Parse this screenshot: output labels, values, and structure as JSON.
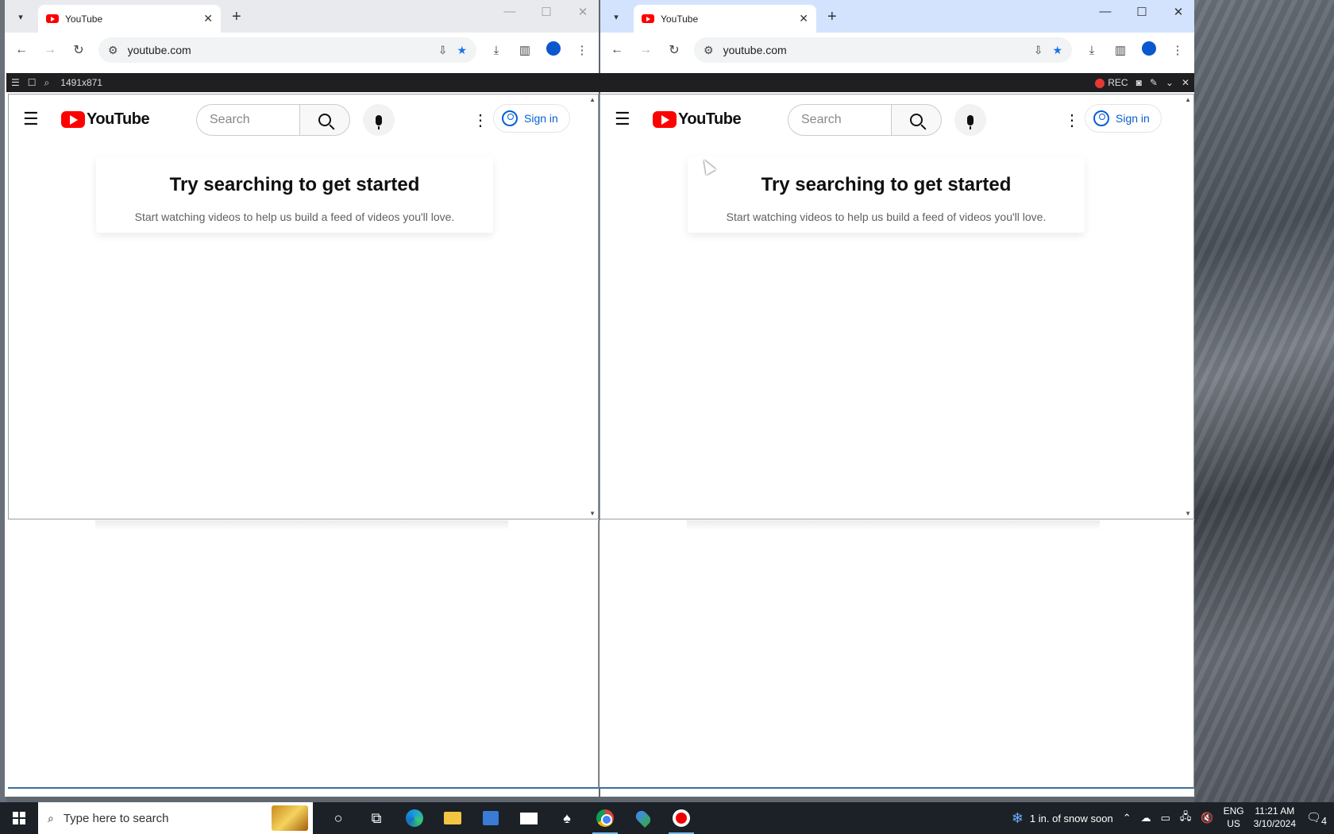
{
  "left_window": {
    "tab_title": "YouTube",
    "url": "youtube.com"
  },
  "right_window": {
    "tab_title": "YouTube",
    "url": "youtube.com"
  },
  "recorder": {
    "dimensions": "1491x871",
    "rec_label": "REC"
  },
  "youtube": {
    "logo_text": "YouTube",
    "search_placeholder": "Search",
    "sign_in": "Sign in",
    "card_title": "Try searching to get started",
    "card_subtitle": "Start watching videos to help us build a feed of videos you'll love."
  },
  "taskbar": {
    "search_placeholder": "Type here to search",
    "weather": "1 in. of snow soon",
    "lang_line1": "ENG",
    "lang_line2": "US",
    "time": "11:21 AM",
    "date": "3/10/2024",
    "notification_count": "4"
  }
}
